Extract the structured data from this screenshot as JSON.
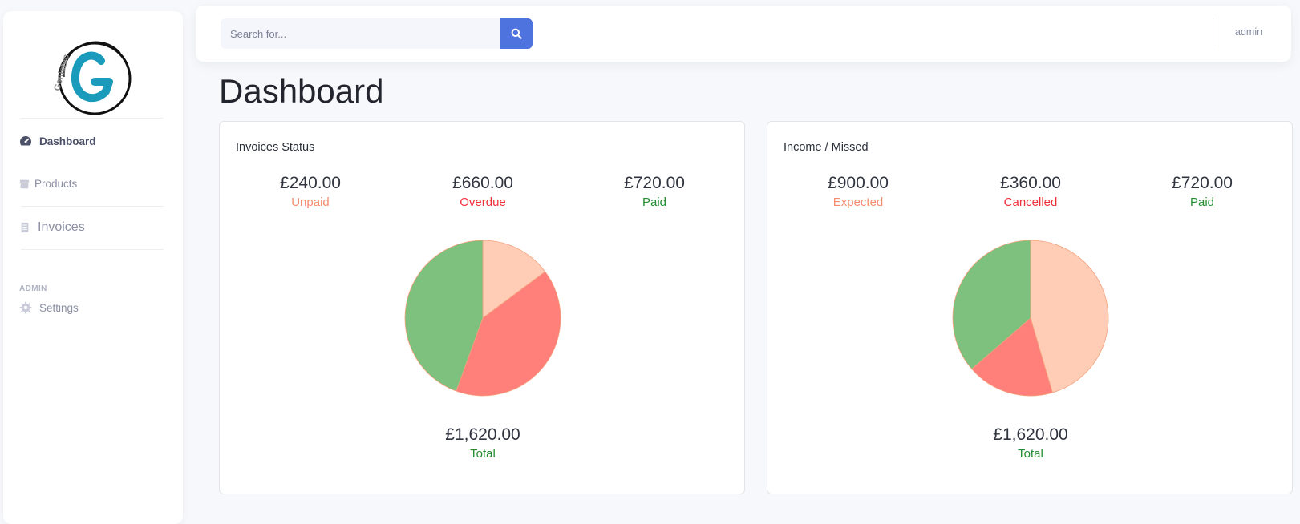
{
  "brand": {
    "logo_text": "Genietec",
    "logo_letter": "G"
  },
  "search": {
    "placeholder": "Search for..."
  },
  "user": {
    "name": "admin"
  },
  "sidebar": {
    "items": [
      {
        "label": "Dashboard",
        "icon": "tachometer-icon"
      },
      {
        "label": "Products",
        "icon": "box-icon"
      },
      {
        "label": "Invoices",
        "icon": "document-icon"
      }
    ],
    "section_label": "ADMIN",
    "admin_items": [
      {
        "label": "Settings",
        "icon": "gear-icon"
      }
    ]
  },
  "page": {
    "title": "Dashboard"
  },
  "colors": {
    "orange_slice": "#ffccb5",
    "red_slice": "#ff7f7a",
    "green_slice": "#7ec07e",
    "label_orange": "#f48d6f",
    "label_red": "#f0303a",
    "label_green": "#238c32",
    "accent": "#4e73df"
  },
  "cards": [
    {
      "title": "Invoices Status",
      "stats": [
        {
          "amount": "£240.00",
          "label": "Unpaid"
        },
        {
          "amount": "£660.00",
          "label": "Overdue"
        },
        {
          "amount": "£720.00",
          "label": "Paid"
        }
      ],
      "total": {
        "amount": "£1,620.00",
        "label": "Total"
      }
    },
    {
      "title": "Income / Missed",
      "stats": [
        {
          "amount": "£900.00",
          "label": "Expected"
        },
        {
          "amount": "£360.00",
          "label": "Cancelled"
        },
        {
          "amount": "£720.00",
          "label": "Paid"
        }
      ],
      "total": {
        "amount": "£1,620.00",
        "label": "Total"
      }
    }
  ],
  "chart_data": [
    {
      "type": "pie",
      "categories": [
        "Unpaid",
        "Overdue",
        "Paid"
      ],
      "values": [
        240,
        660,
        720
      ],
      "colors": [
        "#ffccb5",
        "#ff7f7a",
        "#7ec07e"
      ]
    },
    {
      "type": "pie",
      "categories": [
        "Expected",
        "Cancelled",
        "Paid"
      ],
      "values": [
        900,
        360,
        720
      ],
      "colors": [
        "#ffccb5",
        "#ff7f7a",
        "#7ec07e"
      ]
    }
  ]
}
